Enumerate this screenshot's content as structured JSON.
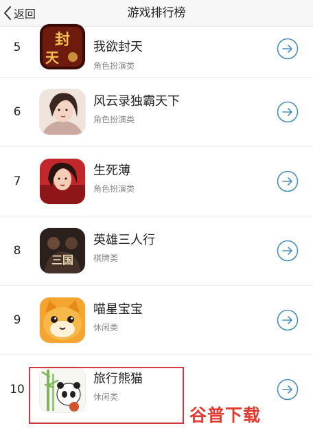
{
  "header": {
    "back_label": "返回",
    "title": "游戏排行榜"
  },
  "games": [
    {
      "rank": "5",
      "name": "我欲封天",
      "category": "角色扮演类",
      "icon": "game-icon-wo-yu-feng-tian"
    },
    {
      "rank": "6",
      "name": "风云录独霸天下",
      "category": "角色扮演类",
      "icon": "game-icon-feng-yun-lu"
    },
    {
      "rank": "7",
      "name": "生死薄",
      "category": "角色扮演类",
      "icon": "game-icon-sheng-si-bu"
    },
    {
      "rank": "8",
      "name": "英雄三人行",
      "category": "棋牌类",
      "icon": "game-icon-ying-xiong-san-ren-xing"
    },
    {
      "rank": "9",
      "name": "喵星宝宝",
      "category": "休闲类",
      "icon": "game-icon-miao-xing-bao-bao"
    },
    {
      "rank": "10",
      "name": "旅行熊猫",
      "category": "休闲类",
      "icon": "game-icon-lv-xing-xiong-mao"
    }
  ],
  "highlighted_rank": "10",
  "watermark": "谷普下载",
  "colors": {
    "arrow": "#4a90b8",
    "highlight_border": "#d1363c",
    "watermark": "#e23a30",
    "nav_background": "#f7f7f7"
  }
}
